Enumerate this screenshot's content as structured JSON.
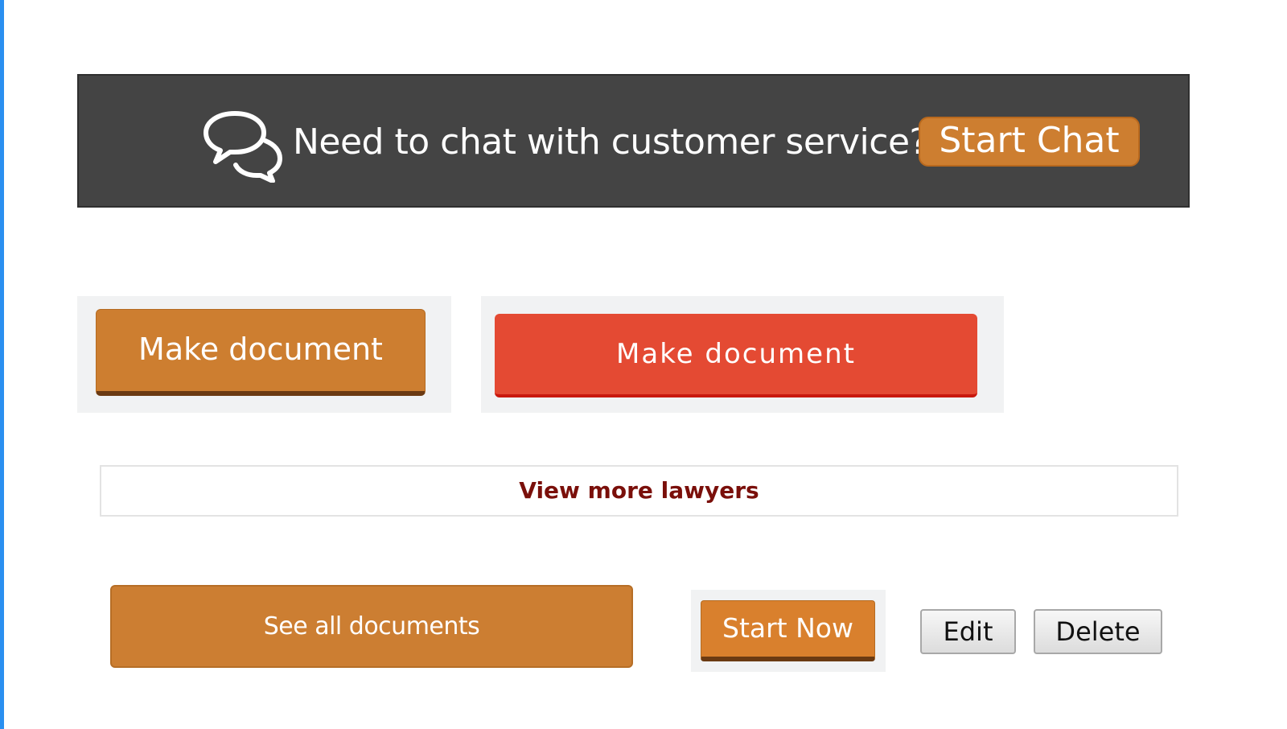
{
  "chat_banner": {
    "text": "Need to chat with customer service?",
    "button_label": "Start Chat",
    "icon": "chat-bubbles-icon"
  },
  "buttons": {
    "make_document_orange": "Make document",
    "make_document_red": "Make document",
    "view_more_lawyers": "View more lawyers",
    "see_all_documents": "See all documents",
    "start_now": "Start Now",
    "edit": "Edit",
    "delete": "Delete"
  },
  "colors": {
    "banner_background": "#444444",
    "orange_accent": "#cd7e30",
    "red_accent": "#e44a33",
    "link_text": "#7a0f0a",
    "page_edge": "#2a8ff0"
  }
}
